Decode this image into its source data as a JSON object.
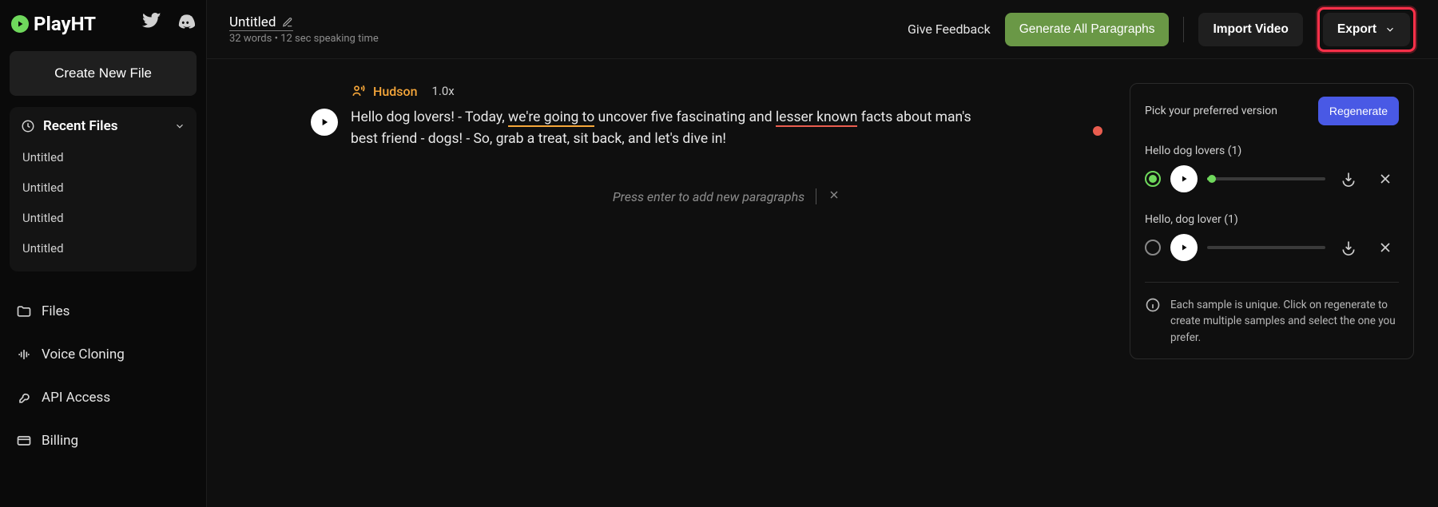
{
  "logo": {
    "text": "PlayHT"
  },
  "sidebar": {
    "create_label": "Create New File",
    "recent_label": "Recent Files",
    "recent_items": [
      "Untitled",
      "Untitled",
      "Untitled",
      "Untitled"
    ],
    "nav": {
      "files": "Files",
      "voice_cloning": "Voice Cloning",
      "api_access": "API Access",
      "billing": "Billing"
    }
  },
  "topbar": {
    "title": "Untitled",
    "subtitle": "32 words • 12 sec speaking time",
    "feedback": "Give Feedback",
    "generate_all": "Generate All Paragraphs",
    "import_video": "Import Video",
    "export": "Export"
  },
  "editor": {
    "voice_name": "Hudson",
    "speed": "1.0x",
    "paragraph_parts": {
      "p1": "Hello dog lovers! - Today, ",
      "p2": "we're going to",
      "p3": " uncover five fascinating and ",
      "p4": "lesser known",
      "p5": " facts about man's best friend - dogs! - So, grab a treat, sit back, and let's dive in!"
    },
    "hint": "Press enter to add new paragraphs"
  },
  "versions": {
    "header": "Pick your preferred version",
    "regenerate": "Regenerate",
    "items": [
      {
        "label": "Hello dog lovers (1)",
        "selected": true,
        "progress_pct": 4
      },
      {
        "label": "Hello, dog lover (1)",
        "selected": false,
        "progress_pct": 0
      }
    ],
    "info": "Each sample is unique. Click on regenerate to create multiple samples and select the one you prefer."
  }
}
